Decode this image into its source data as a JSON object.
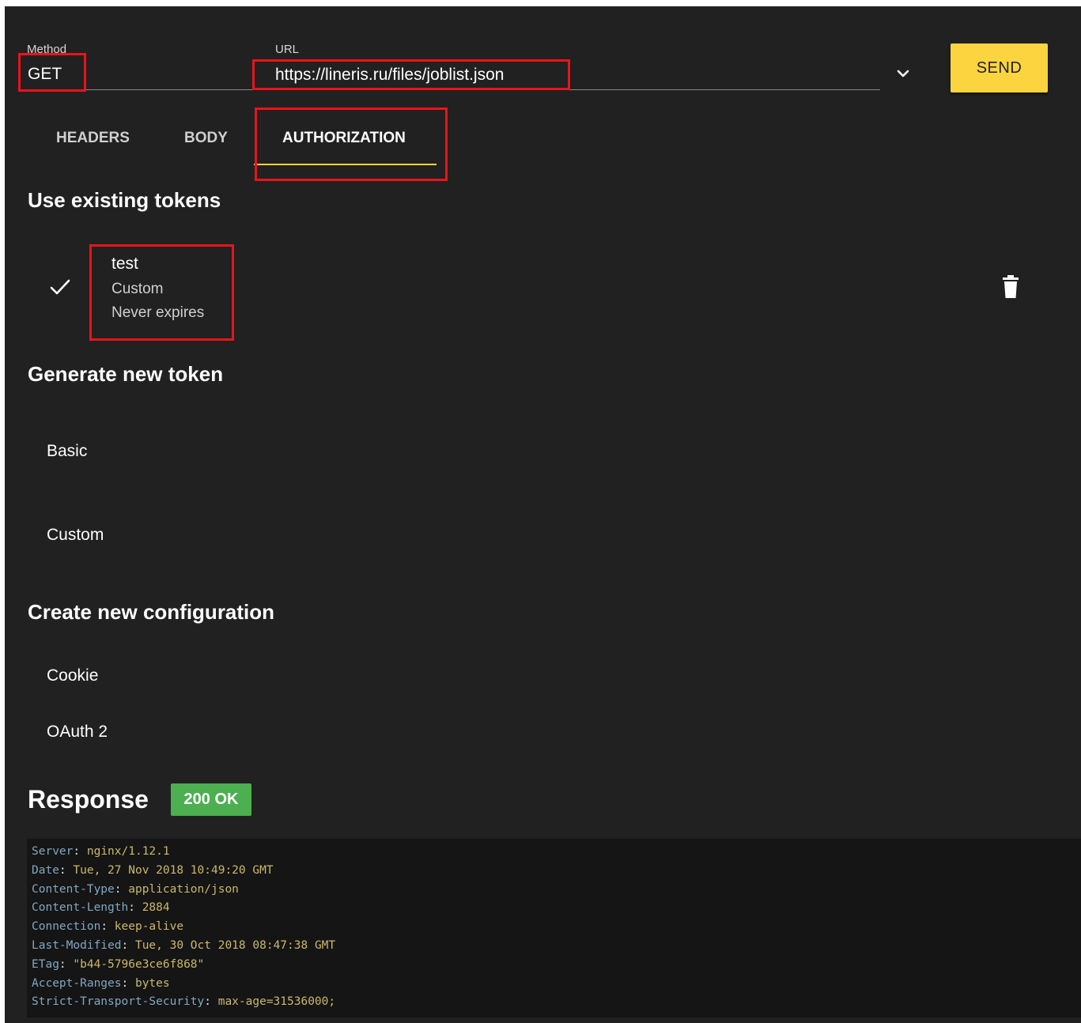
{
  "request": {
    "method_label": "Method",
    "method_value": "GET",
    "url_label": "URL",
    "url_value": "https://lineris.ru/files/joblist.json",
    "send_label": "SEND"
  },
  "tabs": [
    {
      "label": "HEADERS",
      "active": false
    },
    {
      "label": "BODY",
      "active": false
    },
    {
      "label": "AUTHORIZATION",
      "active": true
    }
  ],
  "auth": {
    "existing_title": "Use existing tokens",
    "token": {
      "name": "test",
      "type": "Custom",
      "expiry": "Never expires",
      "selected_icon": "check-icon",
      "delete_icon": "trash-icon"
    },
    "generate_title": "Generate new token",
    "generate_items": [
      "Basic",
      "Custom"
    ],
    "config_title": "Create new configuration",
    "config_items": [
      "Cookie",
      "OAuth 2"
    ]
  },
  "response": {
    "title": "Response",
    "status": "200 OK",
    "status_color": "#4caf50",
    "headers": [
      {
        "key": "Server",
        "value": "nginx/1.12.1"
      },
      {
        "key": "Date",
        "value": "Tue, 27 Nov 2018 10:49:20 GMT"
      },
      {
        "key": "Content-Type",
        "value": "application/json"
      },
      {
        "key": "Content-Length",
        "value": "2884"
      },
      {
        "key": "Connection",
        "value": "keep-alive"
      },
      {
        "key": "Last-Modified",
        "value": "Tue, 30 Oct 2018 08:47:38 GMT"
      },
      {
        "key": "ETag",
        "value": "\"b44-5796e3ce6f868\""
      },
      {
        "key": "Accept-Ranges",
        "value": "bytes"
      },
      {
        "key": "Strict-Transport-Security",
        "value": "max-age=31536000;"
      }
    ]
  },
  "colors": {
    "accent": "#fbd440",
    "highlight": "#e8141b",
    "background": "#212121"
  }
}
